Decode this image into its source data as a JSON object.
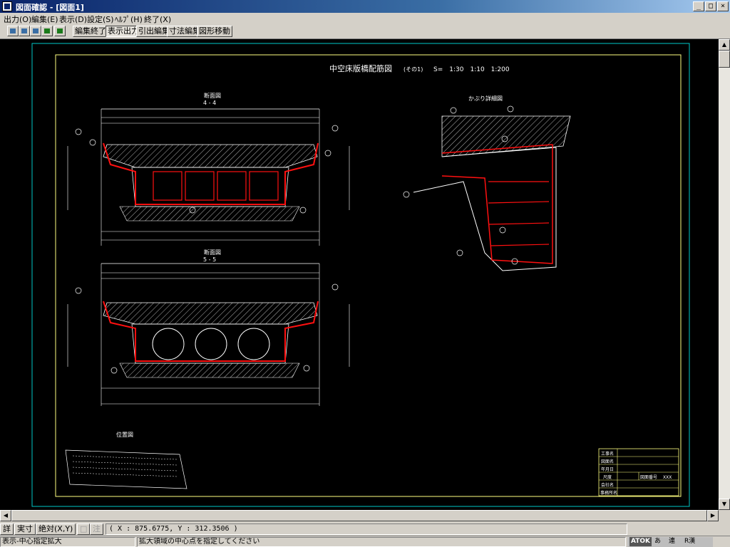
{
  "window": {
    "title": "図面確認 - [図面1]",
    "min": "_",
    "max": "□",
    "close": "×"
  },
  "menu": [
    "出力(O)",
    "編集(E)",
    "表示(D)",
    "設定(S)",
    "ﾍﾙﾌﾟ(H)",
    "終了(X)"
  ],
  "toolbar": {
    "buttons": [
      "編集終了",
      "表示出力",
      "引出編集",
      "寸法編集",
      "図形移動"
    ]
  },
  "drawing": {
    "title": "中空床版橋配筋図",
    "subtitle": "(その1)",
    "scale": "S=　1:30　1:10　1:200",
    "section1_label": "断面図",
    "section1_id": "4 - 4",
    "section2_label": "断面図",
    "section2_id": "5 - 5",
    "detail_label": "かぶり詳細図",
    "location_label": "位置図",
    "titleblock": [
      "工事名",
      "図面名",
      "年月日",
      "尺度",
      "会社名",
      "事務所名"
    ],
    "titleblock_extra": "図面番号",
    "titleblock_extra_value": "XXX",
    "colors": {
      "bar": "#ff1010",
      "line": "#ffffff",
      "frame": "#ffff80",
      "border": "#00c8c8"
    }
  },
  "bottom": {
    "detail": "詳",
    "actual": "実寸",
    "absolute": "絶対(X,Y)",
    "btn_a": "□",
    "btn_b": "注",
    "coord": "( X : 875.6775, Y : 312.3506 )"
  },
  "status": {
    "mode": "表示-中心指定拡大",
    "message": "拡大領域の中心点を指定してください",
    "ime": [
      "ATOK",
      "あ",
      "連",
      "R漢"
    ]
  }
}
